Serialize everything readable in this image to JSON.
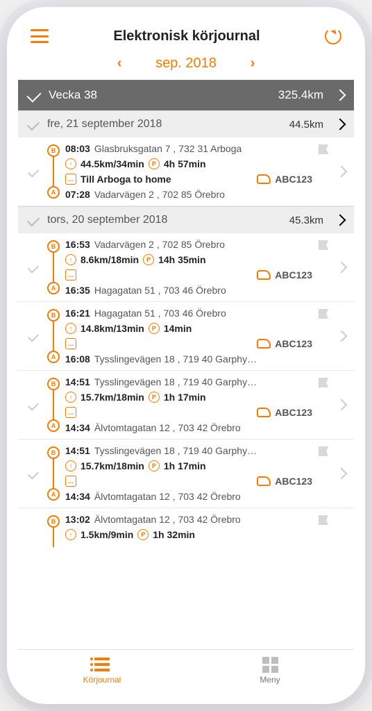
{
  "header": {
    "title": "Elektronisk körjournal"
  },
  "month": {
    "label": "sep. 2018"
  },
  "week": {
    "label": "Vecka 38",
    "km": "325.4km"
  },
  "days": [
    {
      "label": "fre, 21 september 2018",
      "km": "44.5km"
    },
    {
      "label": "tors, 20 september 2018",
      "km": "45.3km"
    }
  ],
  "trips_day0": [
    {
      "end_time": "08:03",
      "end_addr": "Glasbruksgatan 7 , 732 31 Arboga",
      "dist": "44.5km/34min",
      "park": "4h 57min",
      "note": "Till Arboga to home",
      "plate": "ABC123",
      "start_time": "07:28",
      "start_addr": "Vadarvägen 2 , 702 85 Örebro"
    }
  ],
  "trips_day1": [
    {
      "end_time": "16:53",
      "end_addr": "Vadarvägen 2 , 702 85 Örebro",
      "dist": "8.6km/18min",
      "park": "14h 35min",
      "note": "",
      "plate": "ABC123",
      "start_time": "16:35",
      "start_addr": "Hagagatan 51 , 703 46 Örebro"
    },
    {
      "end_time": "16:21",
      "end_addr": "Hagagatan 51 , 703 46 Örebro",
      "dist": "14.8km/13min",
      "park": "14min",
      "note": "",
      "plate": "ABC123",
      "start_time": "16:08",
      "start_addr": "Tysslingevägen 18 , 719 40 Garphy…"
    },
    {
      "end_time": "14:51",
      "end_addr": "Tysslingevägen 18 , 719 40 Garphy…",
      "dist": "15.7km/18min",
      "park": "1h 17min",
      "note": "",
      "plate": "ABC123",
      "start_time": "14:34",
      "start_addr": "Älvtomtagatan 12 , 703 42 Örebro"
    },
    {
      "end_time": "14:51",
      "end_addr": "Tysslingevägen 18 , 719 40 Garphy…",
      "dist": "15.7km/18min",
      "park": "1h 17min",
      "note": "",
      "plate": "ABC123",
      "start_time": "14:34",
      "start_addr": "Älvtomtagatan 12 , 703 42 Örebro"
    },
    {
      "end_time": "13:02",
      "end_addr": "Älvtomtagatan 12 , 703 42 Örebro",
      "dist": "1.5km/9min",
      "park": "1h 32min",
      "note": "",
      "plate": "",
      "start_time": "",
      "start_addr": ""
    }
  ],
  "tabs": {
    "journal": "Körjournal",
    "menu": "Meny"
  }
}
